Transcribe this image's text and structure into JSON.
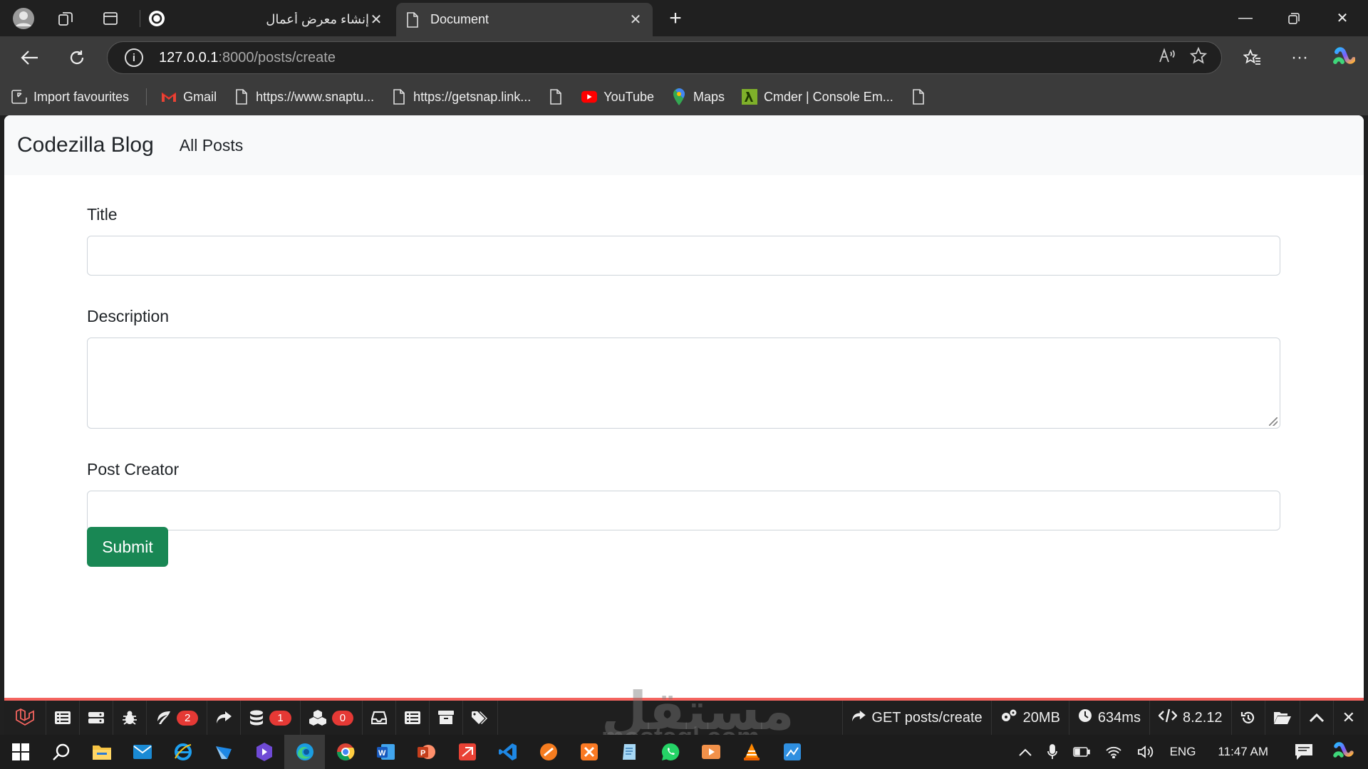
{
  "browser": {
    "tabs": [
      {
        "title": "إنشاء معرض أعمال",
        "active": false
      },
      {
        "title": "Document",
        "active": true
      }
    ],
    "new_tab_symbol": "+",
    "url_host": "127.0.0.1",
    "url_rest": ":8000/posts/create",
    "bookmarks": [
      {
        "label": "Import favourites",
        "icon": "import-icon"
      },
      {
        "label": "Gmail",
        "icon": "gmail-icon"
      },
      {
        "label": "https://www.snaptu...",
        "icon": "page-icon"
      },
      {
        "label": "https://getsnap.link...",
        "icon": "page-icon"
      },
      {
        "label": "",
        "icon": "page-icon"
      },
      {
        "label": "YouTube",
        "icon": "youtube-icon"
      },
      {
        "label": "Maps",
        "icon": "maps-icon"
      },
      {
        "label": "Cmder | Console Em...",
        "icon": "cmder-icon"
      },
      {
        "label": "",
        "icon": "page-icon"
      }
    ]
  },
  "page": {
    "brand": "Codezilla Blog",
    "nav_link": "All Posts",
    "form": {
      "title_label": "Title",
      "description_label": "Description",
      "creator_label": "Post Creator",
      "submit_label": "Submit"
    }
  },
  "debugbar": {
    "badges": {
      "routes": "2",
      "queries": "1",
      "models": "0"
    },
    "route": "GET posts/create",
    "memory": "20MB",
    "time": "634ms",
    "php": "8.2.12"
  },
  "watermark": {
    "arabic": "مستقل",
    "latin": "mostaql.com"
  },
  "taskbar": {
    "lang": "ENG",
    "clock": "11:47 AM"
  },
  "colors": {
    "submit": "#198754",
    "debug_accent": "#f4645f",
    "badge": "#e53935"
  }
}
